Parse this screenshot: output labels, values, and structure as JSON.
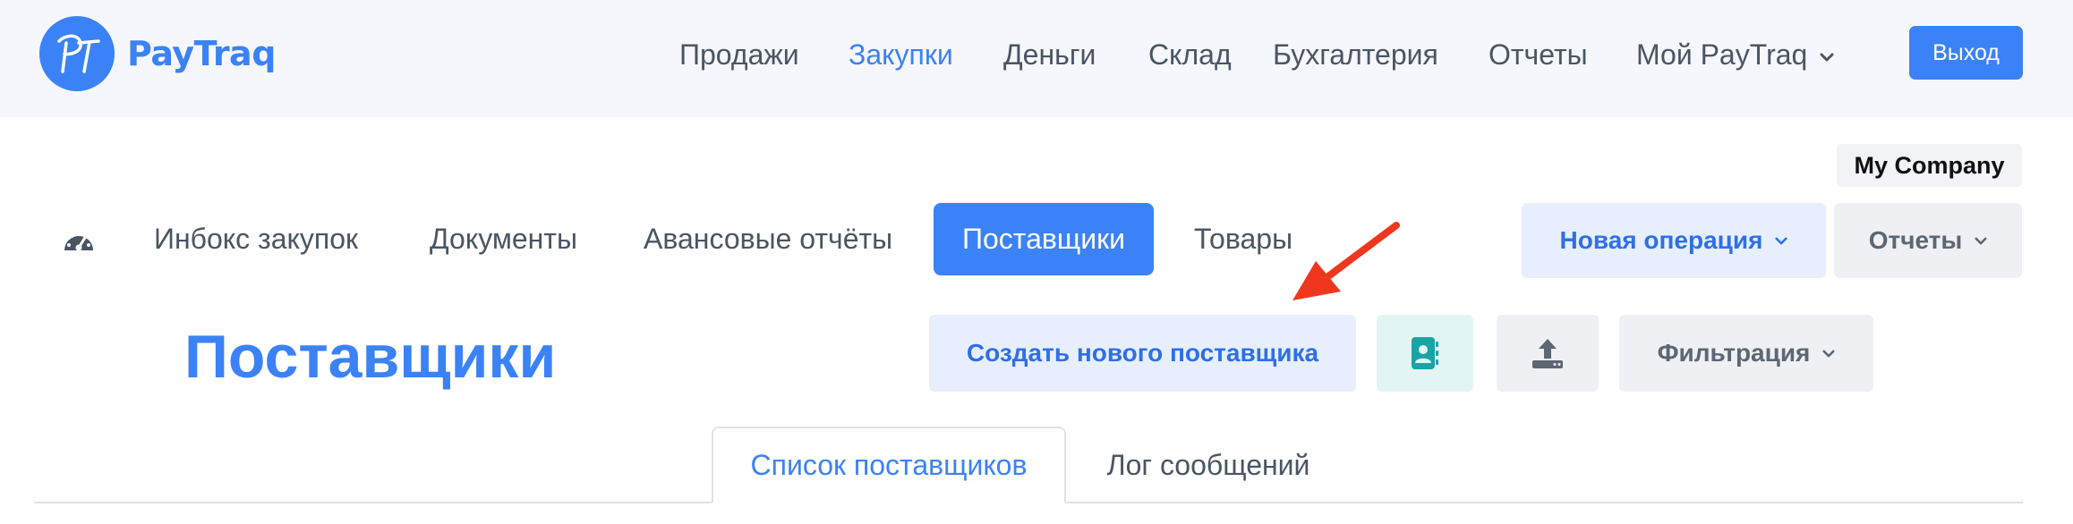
{
  "app": {
    "logo_text": "PayTraq",
    "logo_initials": "PT",
    "brand_color": "#3b82f6"
  },
  "topnav": {
    "items": [
      {
        "label": "Продажи",
        "active": false
      },
      {
        "label": "Закупки",
        "active": true
      },
      {
        "label": "Деньги",
        "active": false
      },
      {
        "label": "Склад",
        "active": false
      },
      {
        "label": "Бухгалтерия",
        "active": false
      },
      {
        "label": "Отчеты",
        "active": false
      },
      {
        "label": "Мой PayTraq",
        "active": false
      }
    ],
    "logout_label": "Выход"
  },
  "company": {
    "name": "My Company"
  },
  "subnav": {
    "items": [
      {
        "label": "Инбокс закупок",
        "active": false
      },
      {
        "label": "Документы",
        "active": false
      },
      {
        "label": "Авансовые отчёты",
        "active": false
      },
      {
        "label": "Поставщики",
        "active": true
      },
      {
        "label": "Товары",
        "active": false
      }
    ],
    "new_operation_label": "Новая операция",
    "reports_label": "Отчеты"
  },
  "page": {
    "title": "Поставщики",
    "create_label": "Создать нового поставщика",
    "filter_label": "Фильтрация"
  },
  "tabs": [
    {
      "label": "Список поставщиков",
      "active": true
    },
    {
      "label": "Лог сообщений",
      "active": false
    }
  ],
  "icons": {
    "dashboard": "speedometer-icon",
    "contacts": "contact-book-icon",
    "upload": "upload-icon",
    "dropdown": "chevron-down-icon"
  },
  "colors": {
    "accent": "#3b82f6",
    "teal": "#1aa3a5",
    "annotation": "#f0361c"
  }
}
